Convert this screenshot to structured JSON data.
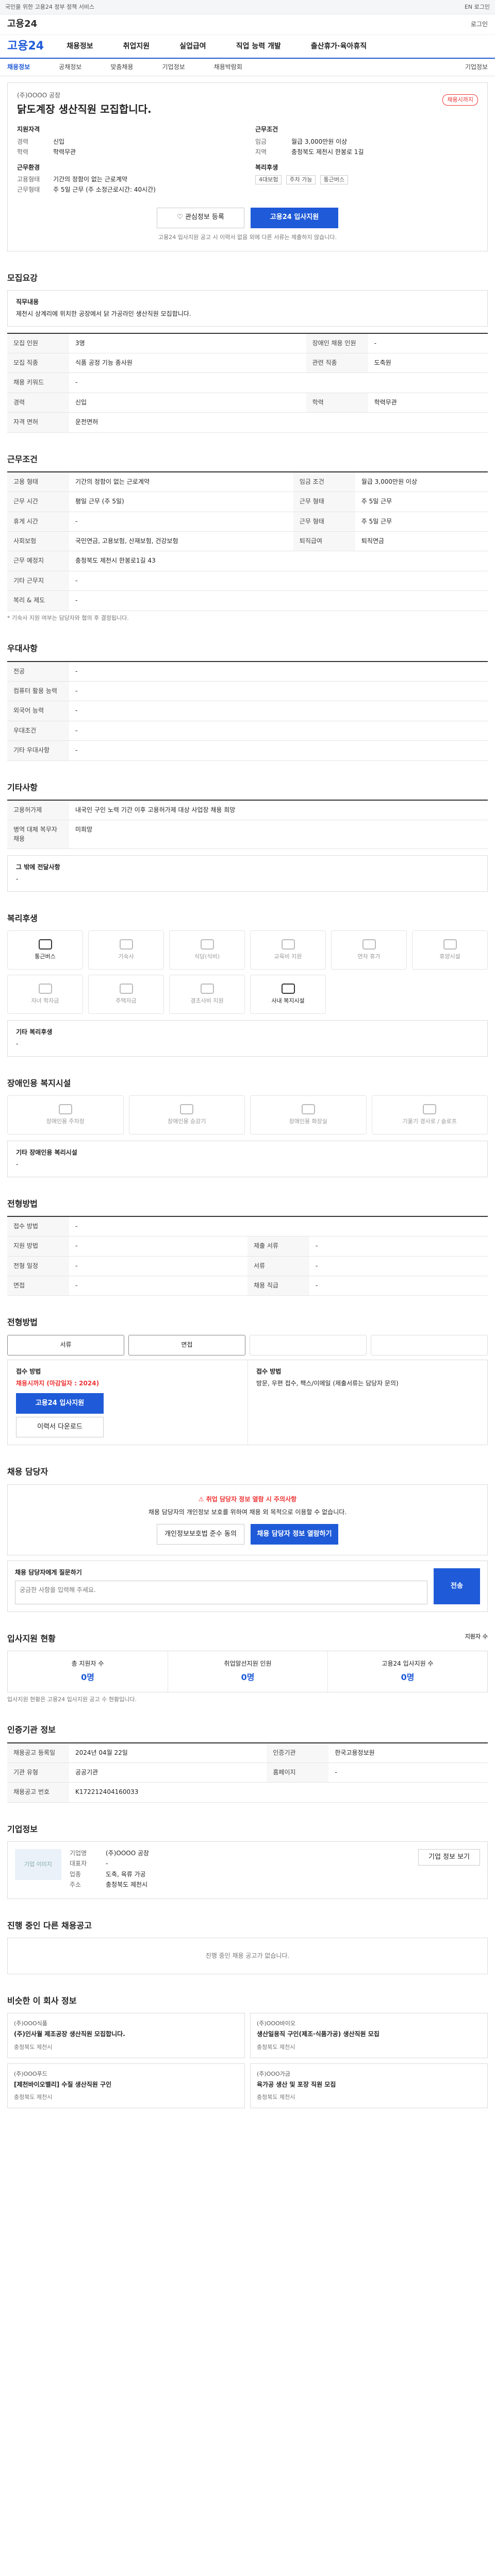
{
  "topbar": {
    "left": "국민을 위한 고용24 정부 정책 서비스",
    "right": "EN 로그인"
  },
  "brandrow": {
    "brand": "고용24",
    "login": "로그인"
  },
  "gnb": {
    "logo": "고용24",
    "items": [
      "채용정보",
      "취업지원",
      "실업급여",
      "직업 능력 개발",
      "출산휴가·육아휴직"
    ]
  },
  "subnav": {
    "items": [
      "채용정보",
      "공채정보",
      "맞춤채용",
      "기업정보",
      "채용박람회"
    ],
    "last": "기업정보"
  },
  "summary": {
    "company": "(주)OOOO 공장",
    "title": "닭도계장 생산직원 모집합니다.",
    "deadline": "채용시까지",
    "left_h": "지원자격",
    "left": [
      [
        "경력",
        "신입"
      ],
      [
        "학력",
        "학력무관"
      ]
    ],
    "left2_h": "근무환경",
    "left2": [
      [
        "고용형태",
        "기간의 정함이 없는 근로계약"
      ],
      [
        "근무형태",
        "주 5일 근무 (주 소정근로시간: 40시간)"
      ]
    ],
    "right_h": "근무조건",
    "right": [
      [
        "임금",
        "월급 3,000만원 이상"
      ],
      [
        "지역",
        "충청북도 제천시 한봉로 1길"
      ]
    ],
    "right2_h": "복리후생",
    "tags": [
      "4대보험",
      "주차 가능",
      "통근버스"
    ],
    "btn_save": "관심정보 등록",
    "btn_apply": "고용24 입사지원",
    "note": "고용24 입사지원 공고 시 이력서 없음 외에 다른 서류는 제출하지 않습니다."
  },
  "s_work": {
    "h": "모집요강",
    "box_h": "직무내용",
    "box_t": "제천시 상계리에 위치한 공장에서 닭 가공라인 생산직원 모집합니다.",
    "rows": [
      [
        "모집 인원",
        "3명",
        "장애인 채용 인원",
        "-"
      ],
      [
        "모집 직종",
        "식품 공정 기능 종사원",
        "관련 직종",
        "도축원"
      ],
      [
        "채용 키워드",
        "-",
        "",
        ""
      ],
      [
        "경력",
        "신입",
        "학력",
        "학력무관"
      ],
      [
        "자격 면허",
        "운전면허",
        "",
        ""
      ]
    ]
  },
  "s_cond": {
    "h": "근무조건",
    "rows": [
      [
        "고용 형태",
        "기간의 정함이 없는 근로계약",
        "임금 조건",
        "월급 3,000만원 이상"
      ],
      [
        "근무 시간",
        "평일 근무 (주 5일)",
        "근무 형태",
        "주 5일 근무"
      ],
      [
        "휴게 시간",
        "-",
        "근무 형태",
        "주 5일 근무"
      ],
      [
        "사회보험",
        "국민연금, 고용보험, 산재보험, 건강보험",
        "퇴직급여",
        "퇴직연금"
      ],
      [
        "근무 예정지",
        "충청북도 제천시 한봉로1길 43",
        "",
        ""
      ],
      [
        "기타 근무지",
        "-",
        "",
        ""
      ],
      [
        "복리 & 제도",
        "-",
        "",
        ""
      ]
    ],
    "foot": "* 기숙사 지원 여부는 담당자와 협의 후 결정됩니다."
  },
  "s_pref": {
    "h": "우대사항",
    "rows": [
      [
        "전공",
        "-"
      ],
      [
        "컴퓨터 활용 능력",
        "-"
      ],
      [
        "외국어 능력",
        "-"
      ],
      [
        "우대조건",
        "-"
      ],
      [
        "기타 우대사항",
        "-"
      ]
    ]
  },
  "s_etc": {
    "h": "기타사항",
    "rows": [
      [
        "고용허가제",
        "내국인 구인 노력 기간 이후 고용허가제 대상 사업장 채용 희망"
      ],
      [
        "병역 대체 복무자 채용",
        "미희망"
      ]
    ],
    "h2": "그 밖에 전달사항",
    "v2": "-"
  },
  "s_welfare": {
    "h": "복리후생",
    "cards": [
      "통근버스",
      "기숙사",
      "식당(식비)",
      "교육비 지원",
      "연차 휴가",
      "휴양시설"
    ],
    "cards2": [
      "자녀 학자금",
      "주택자금",
      "경조사비 지원",
      "사내 복지시설",
      "",
      ""
    ],
    "etc_h": "기타 복리후생",
    "etc_v": "-"
  },
  "s_disab": {
    "h": "장애인용 복지시설",
    "cards": [
      "장애인용 주차장",
      "장애인용 승강기",
      "장애인용 화장실",
      "기울기 경사로 / 슬로프"
    ],
    "etc_h": "기타 장애인용 복리시설",
    "etc_v": "-"
  },
  "s_proc": {
    "h": "전형방법",
    "rows": [
      [
        "접수 방법",
        "-",
        "",
        ""
      ],
      [
        "지원 방법",
        "-",
        "제출 서류",
        "-"
      ],
      [
        "전형 일정",
        "-",
        "서류",
        "-"
      ],
      [
        "면접",
        "-",
        "채용 직급",
        "-"
      ]
    ]
  },
  "s_apply": {
    "h": "전형방법",
    "steps": [
      "서류",
      "면접",
      "",
      ""
    ],
    "left_h": "접수 방법",
    "left_red": "채용시까지 (마감일자 : 2024)",
    "btn": "고용24 입사지원",
    "btn2": "이력서 다운로드",
    "right_h": "접수 방법",
    "right": "방문, 우편 접수, 팩스/이메일 (제출서류는 담당자 문의)"
  },
  "s_notice": {
    "h": "채용 담당자",
    "warn": "취업 담당자 정보 열람 시 주의사항",
    "t1": "채용 담당자의 개인정보 보호를 위하여 채용 외 목적으로 이용할 수 없습니다.",
    "btn1": "개인정보보호법 준수 동의",
    "btn2": "채용 담당자 정보 열람하기"
  },
  "s_inq": {
    "label": "채용 담당자에게 질문하기",
    "placeholder": "궁금한 사항을 입력해 주세요.",
    "send": "전송"
  },
  "s_stats": {
    "h": "입사지원 현황",
    "right": "지원자 수",
    "items": [
      [
        "총 지원자 수",
        "0명"
      ],
      [
        "취업알선지원 인원",
        "0명"
      ],
      [
        "고용24 입사지원 수",
        "0명"
      ]
    ],
    "note": "입사지원 현황은 고용24 입사지원 공고 수 현황입니다."
  },
  "s_info": {
    "h": "인증기관 정보",
    "rows": [
      [
        "채용공고 등록일",
        "2024년 04월 22일",
        "인증기관",
        "한국고용정보원"
      ],
      [
        "기관 유형",
        "공공기관",
        "홈페이지",
        "-"
      ],
      [
        "채용공고 번호",
        "K172212404160033",
        "",
        ""
      ]
    ]
  },
  "s_company": {
    "h": "기업정보",
    "img": "기업 이미지",
    "rows": [
      [
        "기업명",
        "(주)OOOO 공장"
      ],
      [
        "대표자",
        "-"
      ],
      [
        "업종",
        "도축, 육류 가공"
      ],
      [
        "주소",
        "충청북도 제천시"
      ]
    ],
    "btn": "기업 정보 보기"
  },
  "s_other": {
    "h": "진행 중인 다른 채용공고",
    "empty": "진행 중인 채용 공고가 없습니다."
  },
  "s_similar": {
    "h": "비슷한 이 회사 정보",
    "cards": [
      [
        "(주)OOO식품",
        "(주)인사월 제조공장 생산직원 모집합니다.",
        "충청북도 제천시"
      ],
      [
        "(주)OOO바이오",
        "생산일용직 구인(제조·식품가공) 생산직원 모집",
        "충청북도 제천시"
      ],
      [
        "(주)OOO푸드",
        "[제천바이오밸리] 수질 생산직원 구인",
        "충청북도 제천시"
      ],
      [
        "(주)OOO가금",
        "육가공 생산 및 포장 직원 모집",
        "충청북도 제천시"
      ]
    ]
  }
}
